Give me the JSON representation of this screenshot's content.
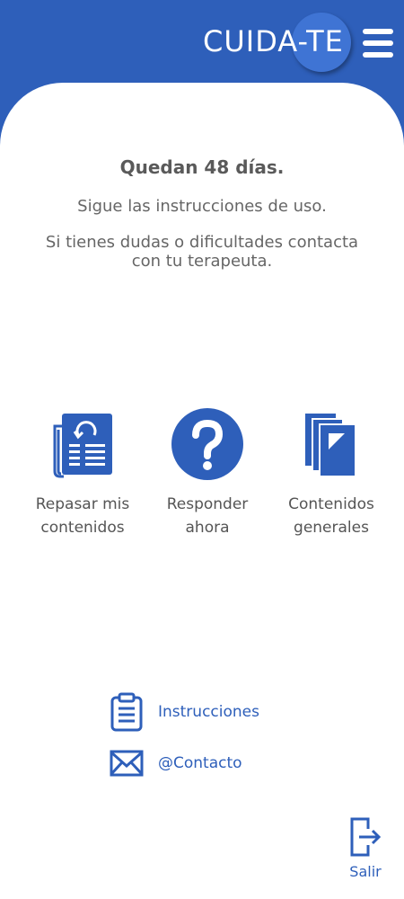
{
  "header": {
    "logo_text": "CUIDA-TE"
  },
  "info": {
    "days_remaining": "Quedan 48 días.",
    "instructions_hint": "Sigue las instrucciones de uso.",
    "doubts_line1": "Si tienes dudas o dificultades contacta",
    "doubts_line2": "con tu terapeuta."
  },
  "tiles": [
    {
      "line1": "Repasar mis",
      "line2": "contenidos",
      "icon": "newspaper-refresh-icon"
    },
    {
      "line1": "Responder",
      "line2": "ahora",
      "icon": "question-circle-icon"
    },
    {
      "line1": "Contenidos",
      "line2": "generales",
      "icon": "books-icon"
    }
  ],
  "links": {
    "instructions": "Instrucciones",
    "contact": "@Contacto"
  },
  "footer": {
    "exit_label": "Salir"
  },
  "colors": {
    "brand": "#2e5fba",
    "text": "#555555",
    "background": "#ffffff"
  }
}
